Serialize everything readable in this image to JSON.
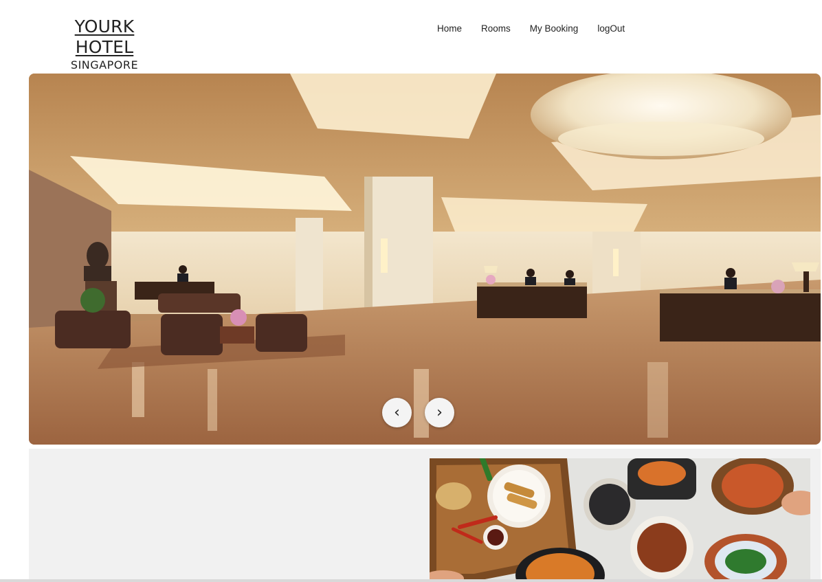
{
  "brand": {
    "title": "YOURK HOTEL",
    "subtitle": "SINGAPORE"
  },
  "nav": {
    "items": [
      "Home",
      "Rooms",
      "My Booking",
      "logOut"
    ]
  },
  "carousel": {
    "prev_label": "‹",
    "next_label": "›"
  },
  "colors": {
    "text": "#222222",
    "section_bg": "#f1f1f1",
    "button_bg": "#f4f4f4"
  }
}
